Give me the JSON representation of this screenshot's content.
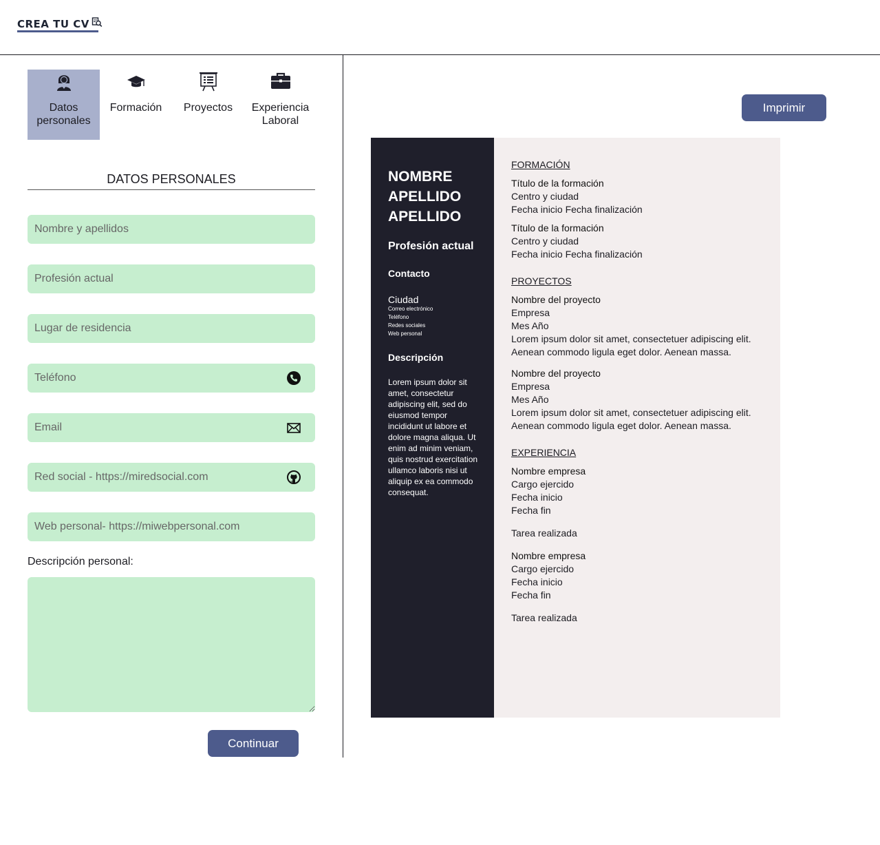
{
  "header": {
    "logo_text": "CREA TU CV",
    "logo_icon": "magnifier-document-icon"
  },
  "tabs": [
    {
      "label": "Datos\npersonales",
      "icon": "user-icon",
      "active": true
    },
    {
      "label": "Formación",
      "icon": "graduation-cap-icon",
      "active": false
    },
    {
      "label": "Proyectos",
      "icon": "presentation-board-icon",
      "active": false
    },
    {
      "label": "Experiencia\nLaboral",
      "icon": "briefcase-icon",
      "active": false
    }
  ],
  "form": {
    "section_title": "DATOS PERSONALES",
    "fields": {
      "name": "Nombre y apellidos",
      "profession": "Profesión actual",
      "residence": "Lugar de residencia",
      "phone": "Teléfono",
      "email": "Email",
      "social": "Red social - https://miredsocial.com",
      "web": "Web personal- https://miwebpersonal.com"
    },
    "description_label": "Descripción personal:",
    "description_value": "",
    "continue_label": "Continuar"
  },
  "preview": {
    "print_label": "Imprimir",
    "sidebar": {
      "name_lines": [
        "NOMBRE",
        "APELLIDO",
        "APELLIDO"
      ],
      "profession": "Profesión actual",
      "contact_heading": "Contacto",
      "city": "Ciudad",
      "email": "Correo electrónico",
      "phone": "Teléfono",
      "social": "Redes sociales",
      "web": "Web personal",
      "description_heading": "Descripción",
      "description": "Lorem ipsum dolor sit amet, consectetur adipiscing elit, sed do eiusmod tempor incididunt ut labore et dolore magna aliqua. Ut enim ad minim veniam, quis nostrud exercitation ullamco laboris nisi ut aliquip ex ea commodo consequat."
    },
    "formacion": {
      "heading": "FORMACIÓN",
      "items": [
        {
          "title": "Título de la formación",
          "place": "Centro y ciudad",
          "dates": "Fecha inicio Fecha finalización"
        },
        {
          "title": "Título de la formación",
          "place": "Centro y ciudad",
          "dates": "Fecha inicio Fecha finalización"
        }
      ]
    },
    "proyectos": {
      "heading": "PROYECTOS",
      "items": [
        {
          "title": "Nombre del proyecto",
          "company": "Empresa",
          "date": "Mes Año",
          "text": "Lorem ipsum dolor sit amet, consectetuer adipiscing elit. Aenean commodo ligula eget dolor. Aenean massa."
        },
        {
          "title": "Nombre del proyecto",
          "company": "Empresa",
          "date": "Mes Año",
          "text": "Lorem ipsum dolor sit amet, consectetuer adipiscing elit. Aenean commodo ligula eget dolor. Aenean massa."
        }
      ]
    },
    "experiencia": {
      "heading": "EXPERIENCIA",
      "items": [
        {
          "company": "Nombre empresa",
          "role": "Cargo ejercido",
          "start": "Fecha inicio",
          "end": "Fecha fin",
          "task": "Tarea realizada"
        },
        {
          "company": "Nombre empresa",
          "role": "Cargo ejercido",
          "start": "Fecha inicio",
          "end": "Fecha fin",
          "task": "Tarea realizada"
        }
      ]
    }
  },
  "colors": {
    "accent": "#4d5b8c",
    "active_tab": "#a8b0cc",
    "field_bg": "#c6eecf",
    "cv_sidebar": "#1f1f2b",
    "cv_main": "#f3eeee"
  }
}
